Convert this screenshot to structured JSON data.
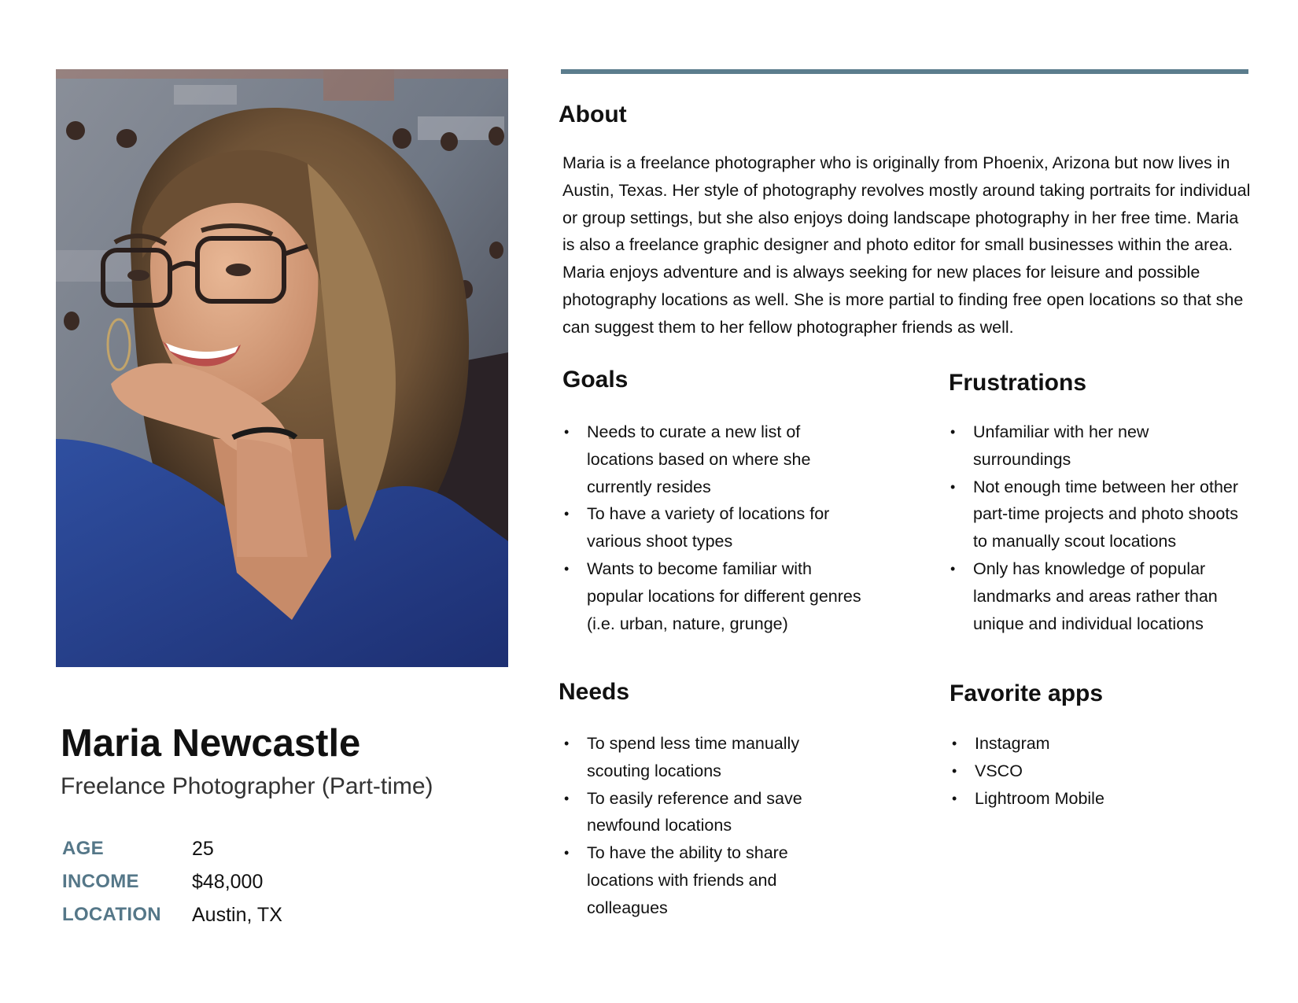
{
  "persona": {
    "name": "Maria Newcastle",
    "role": "Freelance Photographer (Part-time)",
    "stats": [
      {
        "label": "AGE",
        "value": "25"
      },
      {
        "label": "INCOME",
        "value": "$48,000"
      },
      {
        "label": "LOCATION",
        "value": "Austin, TX"
      }
    ]
  },
  "about": {
    "title": "About",
    "text": "Maria is a freelance photographer who is originally from Phoenix, Arizona but now lives in Austin, Texas. Her style of photography revolves mostly around taking portraits for individual or group settings, but she also enjoys doing landscape photography in her free time. Maria is also a freelance graphic designer and photo editor for small businesses within the area. Maria enjoys adventure and is always seeking for new places for leisure and possible photography locations as well. She is more partial to finding free open locations so that she can suggest them to her fellow photographer friends as well."
  },
  "goals": {
    "title": "Goals",
    "items": [
      "Needs to curate a new list of locations based on where she currently resides",
      "To have a variety of locations for various shoot types",
      "Wants to become familiar with popular locations for different genres (i.e. urban, nature, grunge)"
    ]
  },
  "frustrations": {
    "title": "Frustrations",
    "items": [
      "Unfamiliar with her new surroundings",
      "Not enough time between her other part-time projects and photo shoots to manually scout locations",
      "Only has knowledge of popular landmarks and areas rather than unique and individual locations"
    ]
  },
  "needs": {
    "title": "Needs",
    "items": [
      "To spend less time manually scouting locations",
      "To easily reference and save newfound locations",
      "To have the ability to share locations with friends and colleagues"
    ]
  },
  "favorite_apps": {
    "title": "Favorite apps",
    "items": [
      "Instagram",
      "VSCO",
      "Lightroom Mobile"
    ]
  },
  "colors": {
    "accent": "#5b7d8d",
    "label": "#557788",
    "text": "#111111"
  }
}
